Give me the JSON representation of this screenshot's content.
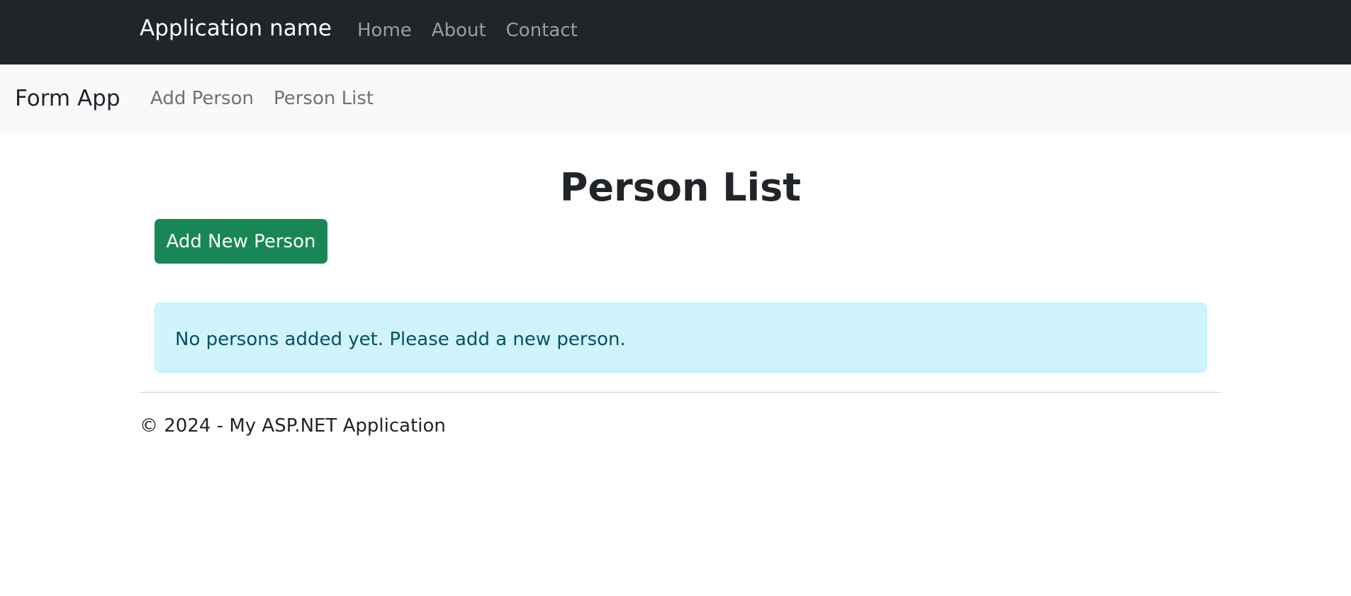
{
  "top_nav": {
    "brand": "Application name",
    "links": [
      "Home",
      "About",
      "Contact"
    ]
  },
  "sub_nav": {
    "brand": "Form App",
    "links": [
      "Add Person",
      "Person List"
    ]
  },
  "main": {
    "title": "Person List",
    "add_button_label": "Add New Person",
    "empty_message": "No persons added yet. Please add a new person."
  },
  "footer": {
    "text": "© 2024 - My ASP.NET Application"
  },
  "colors": {
    "top_nav_bg": "#212529",
    "sub_nav_bg": "#f8f9fa",
    "success": "#198754",
    "info_bg": "#cff4fc",
    "info_text": "#055160"
  }
}
